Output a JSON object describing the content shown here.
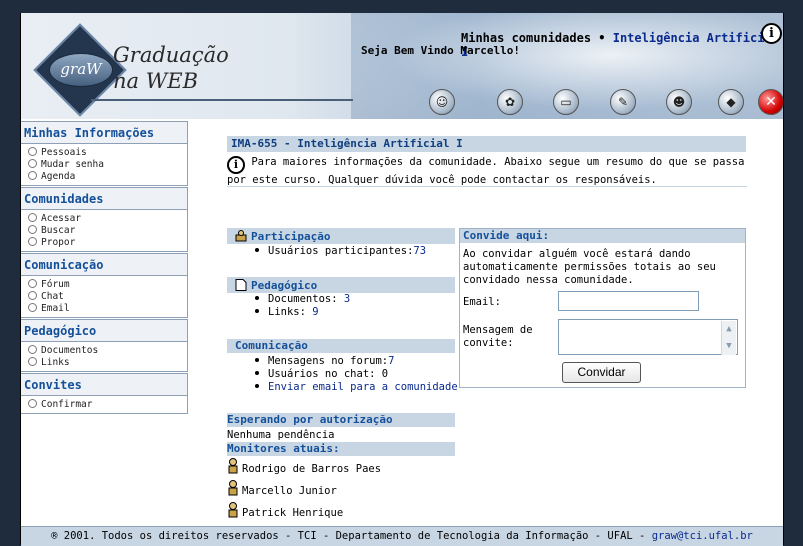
{
  "header": {
    "logo_small": "graW",
    "logo_line1": "Graduação",
    "logo_line2": "na WEB",
    "communities_label": "Minhas comunidades",
    "communities_sep": " • ",
    "current_community": "Inteligência Artificial I",
    "welcome": "Seja Bem Vindo Marcello!",
    "toolbar_icons": [
      "community-icon",
      "people-icon",
      "board-icon",
      "notes-icon",
      "user-icon",
      "book-icon",
      "close-icon"
    ]
  },
  "sidebar": {
    "sections": [
      {
        "title": "Minhas Informações",
        "items": [
          "Pessoais",
          "Mudar senha",
          "Agenda"
        ]
      },
      {
        "title": "Comunidades",
        "items": [
          "Acessar",
          "Buscar",
          "Propor"
        ]
      },
      {
        "title": "Comunicação",
        "items": [
          "Fórum",
          "Chat",
          "Email"
        ]
      },
      {
        "title": "Pedagógico",
        "items": [
          "Documentos",
          "Links"
        ]
      },
      {
        "title": "Convites",
        "items": [
          "Confirmar"
        ]
      }
    ]
  },
  "main": {
    "title": "IMA-655 - Inteligência Artificial I",
    "intro_line1": "Para maiores informações da comunidade. Abaixo segue um resumo do que se passa",
    "intro_line2": "por este curso. Qualquer dúvida você pode contactar os responsáveis.",
    "participacao": {
      "title": "Participação",
      "users_label": "Usuários participantes:",
      "users_count": "73"
    },
    "pedagogico": {
      "title": "Pedagógico",
      "docs_label": "Documentos: ",
      "docs_count": "3",
      "links_label": "Links: ",
      "links_count": "9"
    },
    "comunicacao": {
      "title": "Comunicação",
      "forum_label": "Mensagens no forum:",
      "forum_count": "7",
      "chat_label": "Usuários no chat: ",
      "chat_count": "0",
      "email_link": "Enviar email para a comunidade"
    },
    "esperando": {
      "title": "Esperando por autorização",
      "value": "Nenhuma pendência"
    },
    "monitores": {
      "title": "Monitores atuais:",
      "people": [
        "Rodrigo de Barros Paes",
        "Marcello Junior",
        "Patrick Henrique"
      ]
    },
    "convide": {
      "title": "Convide aqui:",
      "text_line1": "Ao convidar alguém você estará dando",
      "text_line2": "automaticamente permissões totais ao seu",
      "text_line3": "convidado nessa comunidade.",
      "email_label": "Email:",
      "email_value": "",
      "message_label_1": "Mensagem de",
      "message_label_2": "convite:",
      "message_value": "",
      "button": "Convidar"
    }
  },
  "footer": {
    "text": "® 2001. Todos os direitos reservados - TCI - Departamento de Tecnologia da Informação - UFAL - ",
    "email": "graw@tci.ufal.br"
  }
}
